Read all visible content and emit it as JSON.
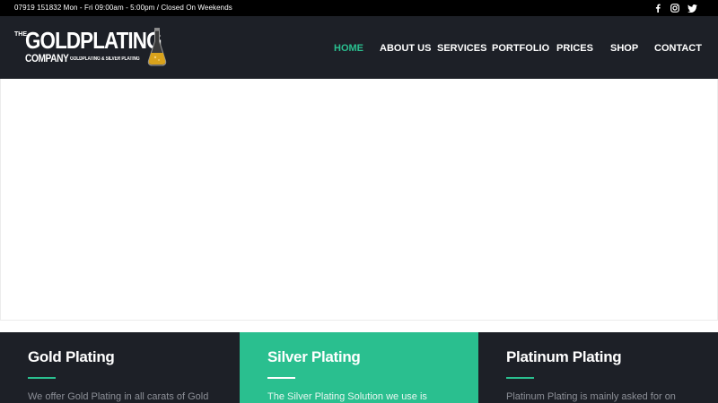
{
  "topbar": {
    "contact_text": "07919 151832 Mon - Fri 09:00am - 5:00pm / Closed On Weekends",
    "social_icons": [
      "facebook-icon",
      "instagram-icon",
      "twitter-icon"
    ]
  },
  "logo": {
    "the": "THE",
    "main": "GOLDPLATING",
    "company": "COMPANY",
    "tagline": "GOLDPLATING & SILVER PLATING"
  },
  "nav": {
    "items": [
      {
        "label": "HOME",
        "active": true
      },
      {
        "label": "ABOUT US",
        "active": false
      },
      {
        "label": "SERVICES",
        "active": false
      },
      {
        "label": "PORTFOLIO",
        "active": false
      },
      {
        "label": "PRICES",
        "active": false
      },
      {
        "label": "SHOP",
        "active": false
      },
      {
        "label": "CONTACT",
        "active": false
      }
    ]
  },
  "features": [
    {
      "title": "Gold Plating",
      "text": "We offer Gold Plating in all carats of Gold"
    },
    {
      "title": "Silver Plating",
      "text": "The Silver Plating Solution we use is"
    },
    {
      "title": "Platinum Plating",
      "text": "Platinum Plating is mainly asked for on"
    }
  ],
  "colors": {
    "accent": "#2abf8f",
    "header_bg": "#1d2027",
    "topbar_bg": "#000000"
  }
}
